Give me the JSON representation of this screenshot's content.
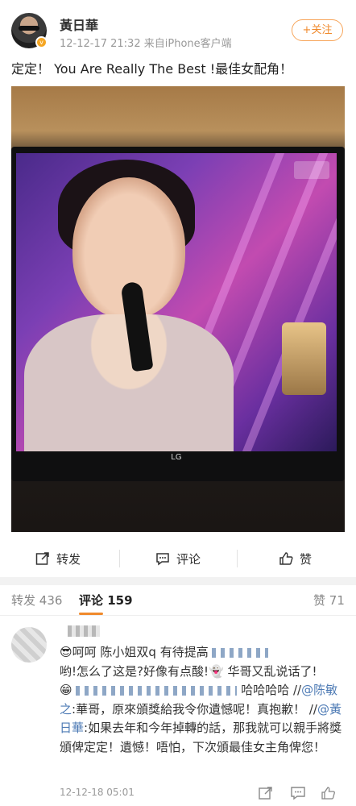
{
  "post": {
    "author": "黃日華",
    "timestamp": "12-12-17 21:32",
    "source": "来自iPhone客户端",
    "follow_label": "+关注",
    "text": "定定！ You Are Really The Best !最佳女配角！",
    "image": {
      "tv_brand": "LG"
    }
  },
  "actions": {
    "repost_label": "转发",
    "comment_label": "评论",
    "like_label": "赞"
  },
  "tabs": {
    "repost_label": "转发",
    "repost_count": "436",
    "comment_label": "评论",
    "comment_count": "159",
    "like_label": "赞",
    "like_count": "71"
  },
  "comment": {
    "line1_text": "呵呵 陈小姐双q 有待提高",
    "line2_a": "哟!怎么了这是?好像有点酸!",
    "line2_b": " 华哥又乱说话了!",
    "line3_tail": "哈哈哈哈 //",
    "mention1": "@陈敏之",
    "reply1": ":華哥，原來頒獎給我令你遺憾呢！真抱歉！ //",
    "mention2": "@黃日華",
    "reply2": ":如果去年和今年掉轉的話，那我就可以親手將獎頒俾定定！遺憾！唔怕，下次頒最佳女主角俾您！",
    "timestamp": "12-12-18 05:01"
  },
  "colors": {
    "accent": "#f08a2c",
    "mention": "#4e7bb5",
    "badge": "#f5a623"
  }
}
